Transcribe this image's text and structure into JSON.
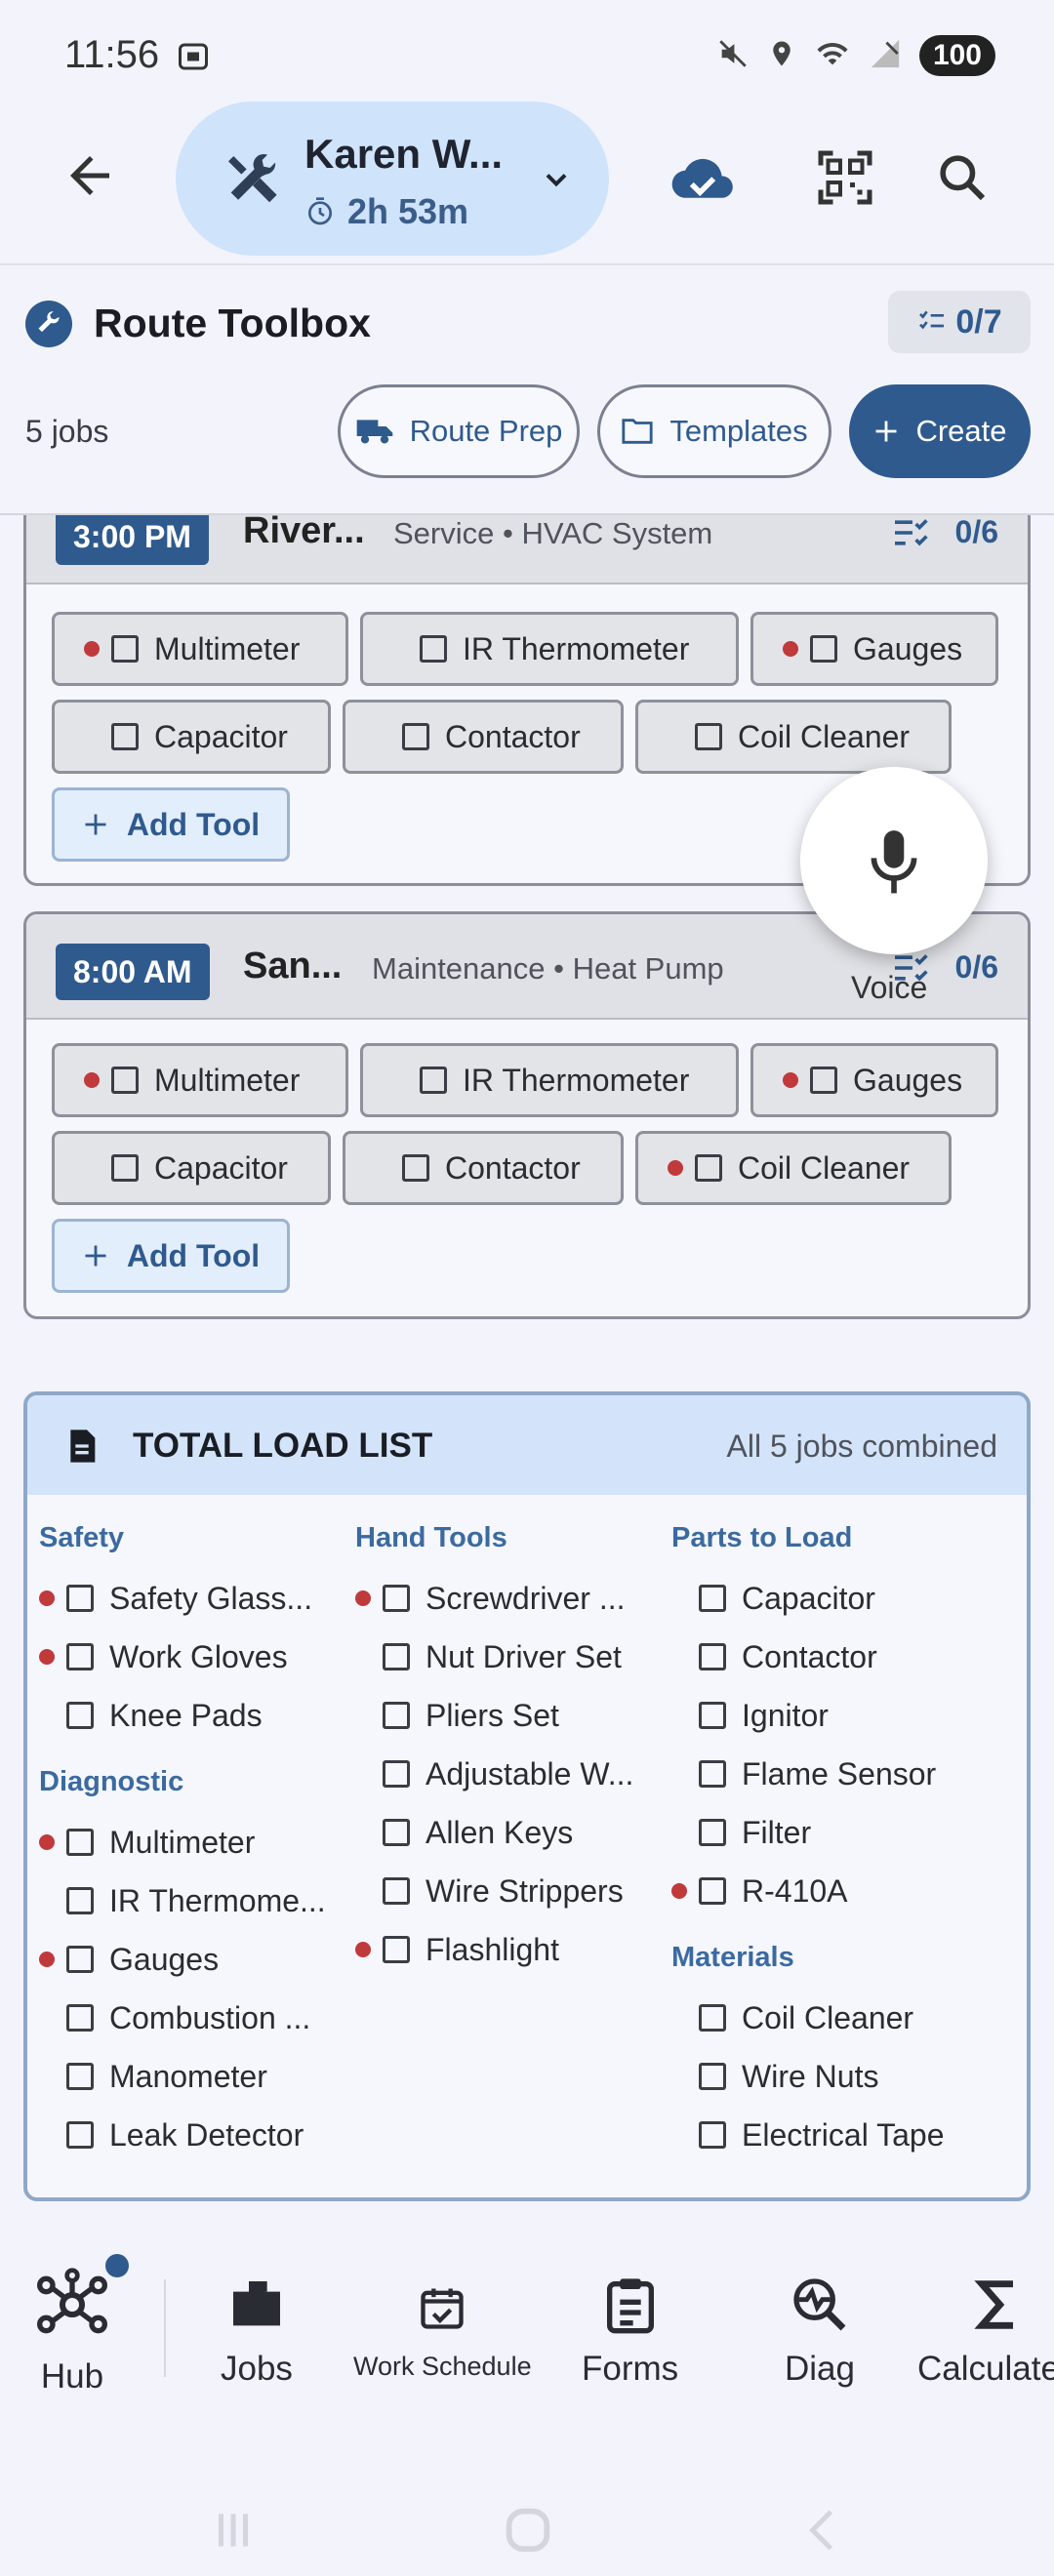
{
  "status": {
    "time": "11:56",
    "battery": "100"
  },
  "header": {
    "session_name": "Karen W...",
    "timer": "2h 53m"
  },
  "toolbox": {
    "title": "Route Toolbox",
    "progress": "0/7",
    "jobs_count": "5 jobs",
    "route_prep": "Route Prep",
    "templates": "Templates",
    "create": "Create"
  },
  "jobs": [
    {
      "time": "3:00 PM",
      "name": "River...",
      "desc": "Service • HVAC System",
      "progress": "0/6",
      "tools": [
        {
          "label": "Multimeter",
          "flag": true
        },
        {
          "label": "IR Thermometer",
          "flag": false
        },
        {
          "label": "Gauges",
          "flag": true
        },
        {
          "label": "Capacitor",
          "flag": false
        },
        {
          "label": "Contactor",
          "flag": false
        },
        {
          "label": "Coil Cleaner",
          "flag": false
        }
      ],
      "add": "Add Tool"
    },
    {
      "time": "8:00 AM",
      "name": "San...",
      "desc": "Maintenance • Heat Pump",
      "progress": "0/6",
      "tools": [
        {
          "label": "Multimeter",
          "flag": true
        },
        {
          "label": "IR Thermometer",
          "flag": false
        },
        {
          "label": "Gauges",
          "flag": true
        },
        {
          "label": "Capacitor",
          "flag": false
        },
        {
          "label": "Contactor",
          "flag": false
        },
        {
          "label": "Coil Cleaner",
          "flag": true
        }
      ],
      "add": "Add Tool"
    }
  ],
  "voice": {
    "label": "Voice"
  },
  "load": {
    "title": "TOTAL LOAD LIST",
    "subtitle": "All 5 jobs combined",
    "safety": {
      "title": "Safety",
      "items": [
        "Safety Glass...",
        "Work Gloves",
        "Knee Pads"
      ]
    },
    "diagnostic": {
      "title": "Diagnostic",
      "items": [
        "Multimeter",
        "IR Thermome...",
        "Gauges",
        "Combustion ...",
        "Manometer",
        "Leak Detector"
      ]
    },
    "hand": {
      "title": "Hand Tools",
      "items": [
        "Screwdriver ...",
        "Nut Driver Set",
        "Pliers Set",
        "Adjustable W...",
        "Allen Keys",
        "Wire Strippers",
        "Flashlight"
      ]
    },
    "parts": {
      "title": "Parts to Load",
      "items": [
        "Capacitor",
        "Contactor",
        "Ignitor",
        "Flame Sensor",
        "Filter",
        "R-410A"
      ]
    },
    "materials": {
      "title": "Materials",
      "items": [
        "Coil Cleaner",
        "Wire Nuts",
        "Electrical Tape"
      ]
    }
  },
  "nav": {
    "hub": "Hub",
    "jobs": "Jobs",
    "schedule": "Work Schedule",
    "forms": "Forms",
    "diag": "Diag",
    "calc": "Calculate"
  },
  "colors": {
    "primary": "#2f5a8e",
    "flag": "#c0393b",
    "accent_bg": "#cfe3fb"
  }
}
